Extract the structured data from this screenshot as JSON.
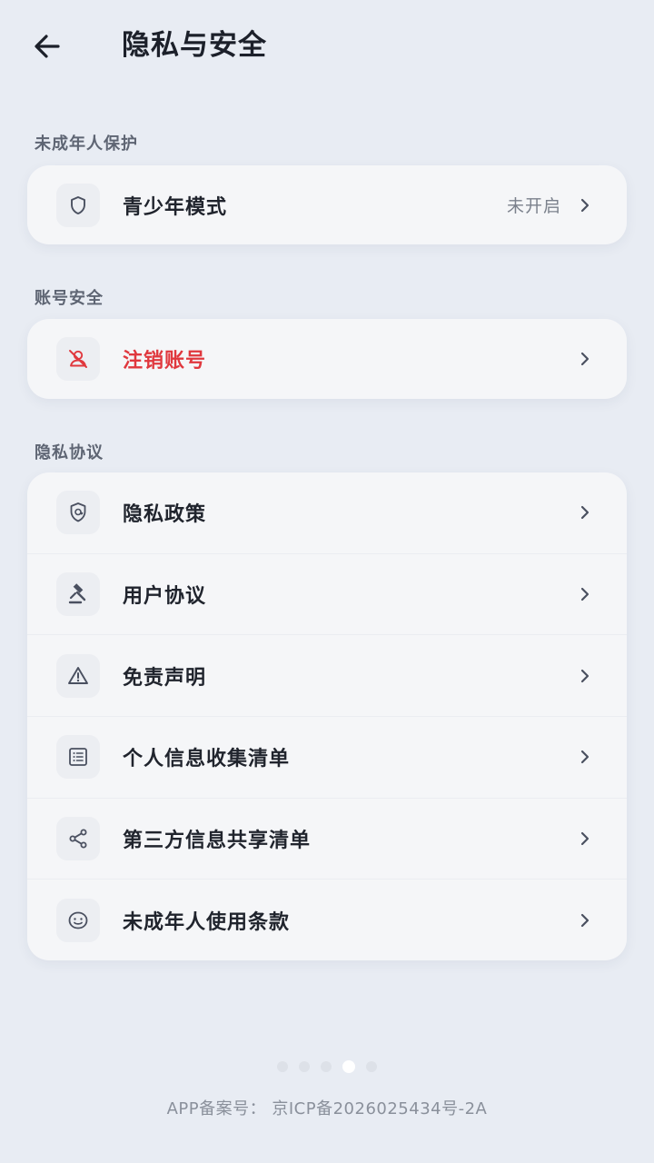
{
  "header": {
    "title": "隐私与安全"
  },
  "sections": [
    {
      "label": "未成年人保护",
      "items": [
        {
          "label": "青少年模式",
          "value": "未开启",
          "icon": "shield-icon"
        }
      ]
    },
    {
      "label": "账号安全",
      "items": [
        {
          "label": "注销账号",
          "icon": "user-remove-icon",
          "danger_color": "#e0383e"
        }
      ]
    },
    {
      "label": "隐私协议",
      "items": [
        {
          "label": "隐私政策",
          "icon": "privacy-shield-icon"
        },
        {
          "label": "用户协议",
          "icon": "gavel-icon"
        },
        {
          "label": "免责声明",
          "icon": "warning-icon"
        },
        {
          "label": "个人信息收集清单",
          "icon": "list-icon"
        },
        {
          "label": "第三方信息共享清单",
          "icon": "share-icon"
        },
        {
          "label": "未成年人使用条款",
          "icon": "smile-icon"
        }
      ]
    }
  ],
  "pager": {
    "count": 5,
    "active_index": 3
  },
  "footer": {
    "text": "APP备案号： 京ICP备2026025434号-2A"
  },
  "colors": {
    "background": "#e8ecf3",
    "card": "#f5f6f8",
    "danger": "#e0383e",
    "text_primary": "#20242d",
    "text_secondary": "#7b818c"
  }
}
